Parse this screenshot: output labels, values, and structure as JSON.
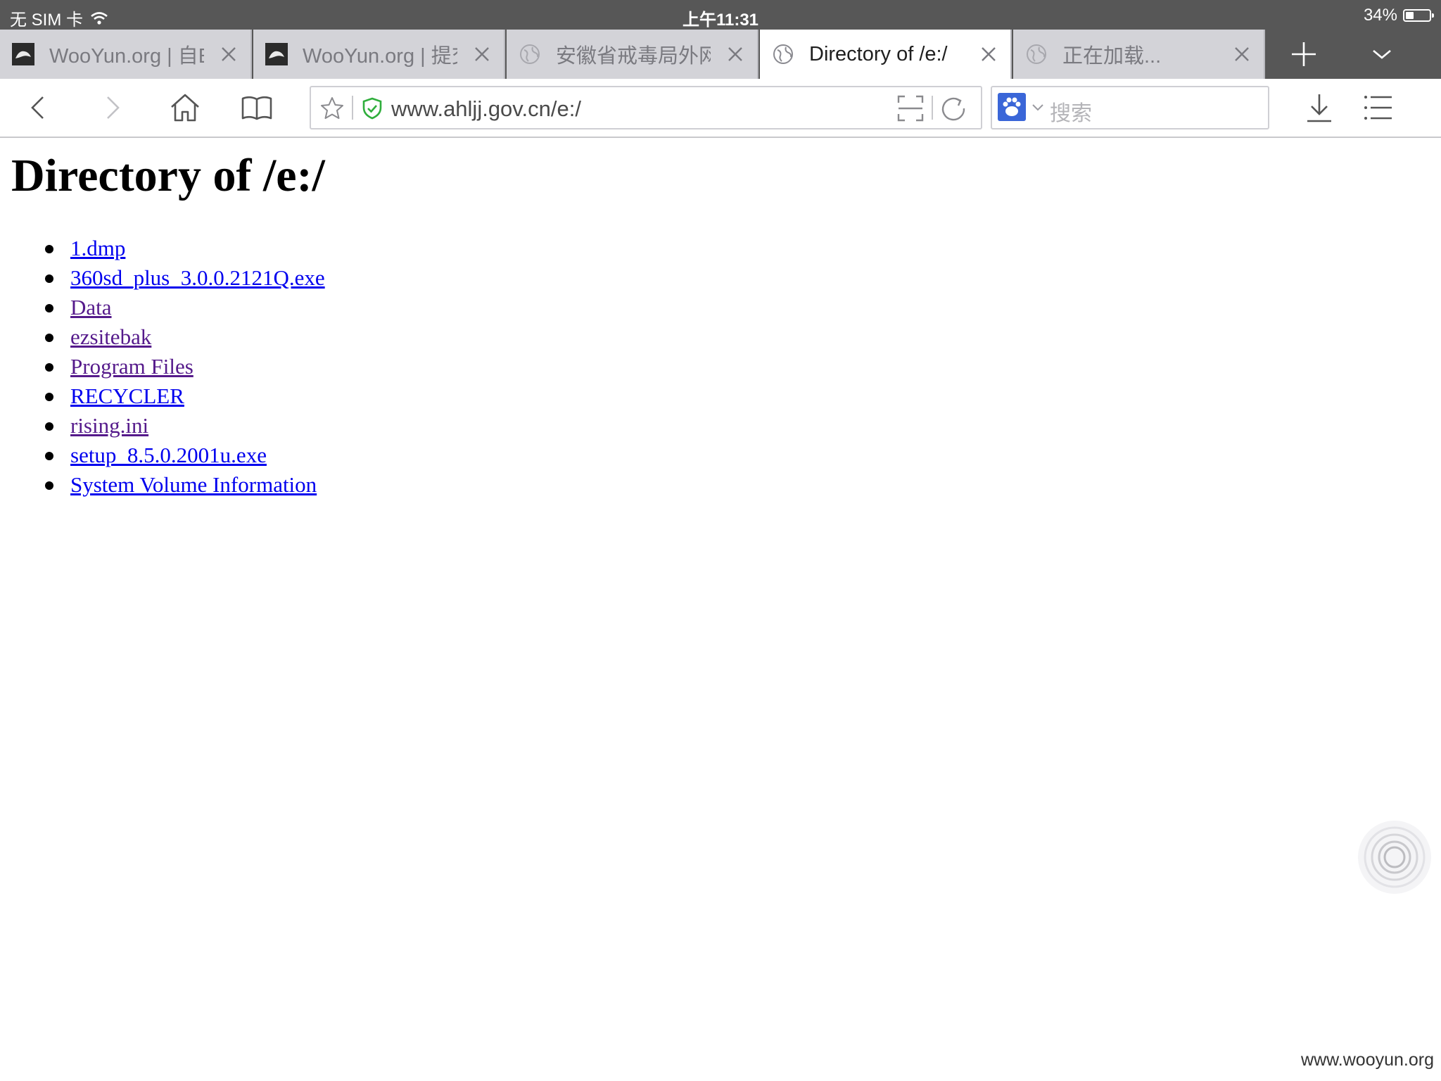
{
  "status_bar": {
    "carrier": "无 SIM 卡",
    "time": "上午11:31",
    "battery_percent_label": "34%",
    "battery_level": 0.34
  },
  "tabs": [
    {
      "title": "WooYun.org | 自E",
      "favicon": "wooyun-icon",
      "active": false
    },
    {
      "title": "WooYun.org | 提交",
      "favicon": "wooyun-icon",
      "active": false
    },
    {
      "title": "安徽省戒毒局外网",
      "favicon": "globe-icon",
      "active": false
    },
    {
      "title": "Directory of /e:/",
      "favicon": "globe-icon",
      "active": true
    },
    {
      "title": "正在加载...",
      "favicon": "globe-icon",
      "active": false
    }
  ],
  "toolbar": {
    "url": "www.ahljj.gov.cn/e:/",
    "search_placeholder": "搜索",
    "icons": [
      "back-icon",
      "forward-icon",
      "home-icon",
      "bookmarks-icon",
      "star-icon",
      "secure-shield-icon",
      "scan-icon",
      "reload-icon",
      "baidu-paw-icon",
      "download-icon",
      "menu-icon"
    ]
  },
  "colors": {
    "chrome_dark": "#575757",
    "tab_inactive": "#d3d3d8",
    "link_unvisited": "#0000ee",
    "link_visited": "#551a8b",
    "secure_green": "#2fae3c",
    "baidu_blue": "#3a66d8"
  },
  "page": {
    "heading": "Directory of /e:/",
    "items": [
      {
        "name": "1.dmp",
        "visited": false
      },
      {
        "name": "360sd_plus_3.0.0.2121Q.exe",
        "visited": false
      },
      {
        "name": "Data",
        "visited": true
      },
      {
        "name": "ezsitebak",
        "visited": true
      },
      {
        "name": "Program Files",
        "visited": true
      },
      {
        "name": "RECYCLER",
        "visited": false
      },
      {
        "name": "rising.ini",
        "visited": true
      },
      {
        "name": "setup_8.5.0.2001u.exe",
        "visited": false
      },
      {
        "name": "System Volume Information",
        "visited": false
      }
    ]
  },
  "watermark": "www.wooyun.org"
}
